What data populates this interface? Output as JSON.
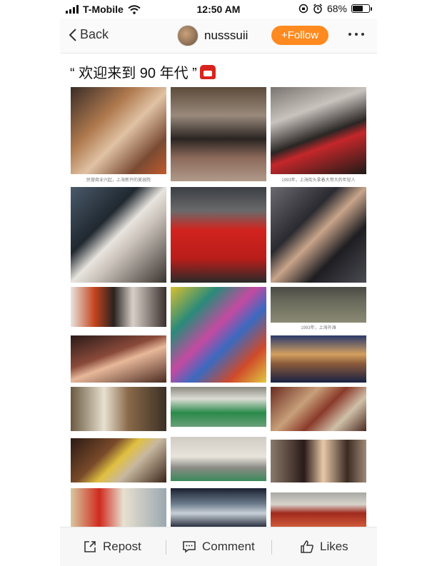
{
  "status": {
    "carrier": "T-Mobile",
    "time": "12:50 AM",
    "battery": "68%",
    "battery_level": 0.68
  },
  "nav": {
    "back_label": "Back",
    "username": "nusssuii",
    "follow_label": "+Follow"
  },
  "post": {
    "title": "“ 欢迎来到 90 年代 ”"
  },
  "captions": {
    "c1": "民营商业兴起，上海新开的美容院",
    "c2": "1993年，上海街头拿着大哥大的年轻人",
    "c3": "1993年，上海外滩"
  },
  "actions": {
    "repost": "Repost",
    "comment": "Comment",
    "likes": "Likes"
  },
  "colors": {
    "accent": "#ff8a1f",
    "phone_emoji": "#d9231e"
  },
  "icons": [
    "back-chevron-icon",
    "wifi-icon",
    "alarm-icon",
    "battery-icon",
    "more-dots-icon",
    "repost-icon",
    "comment-icon",
    "like-icon",
    "telephone-icon"
  ]
}
